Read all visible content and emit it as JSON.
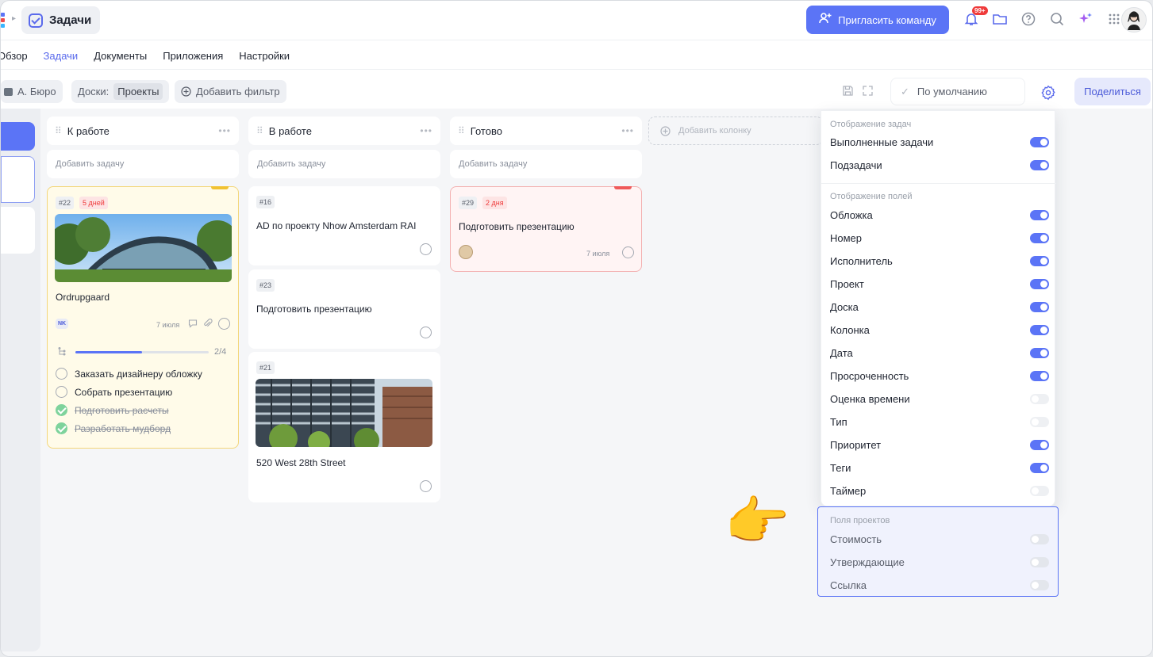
{
  "app": {
    "title": "Задачи",
    "invite_label": "Пригласить команду",
    "notifications_badge": "99+"
  },
  "nav": {
    "tabs": [
      {
        "label": "Обзор",
        "active": false
      },
      {
        "label": "Задачи",
        "active": true
      },
      {
        "label": "Документы",
        "active": false
      },
      {
        "label": "Приложения",
        "active": false
      },
      {
        "label": "Настройки",
        "active": false
      }
    ]
  },
  "filters": {
    "workspace": "А. Бюро",
    "boards_label": "Доски:",
    "boards_value": "Проекты",
    "add_filter": "Добавить фильтр",
    "view": "По умолчанию",
    "share": "Поделиться"
  },
  "board": {
    "add_task_label": "Добавить задачу",
    "add_column_label": "Добавить колонку",
    "columns": [
      {
        "name": "К работе",
        "cards": [
          {
            "number": "#22",
            "overdue": "5 дней",
            "title": "Ordrupgaard",
            "assignee": "NK",
            "date": "7 июля",
            "progress": "2/4",
            "progress_fraction": 0.5,
            "subtasks": [
              {
                "label": "Заказать дизайнеру обложку",
                "done": false
              },
              {
                "label": "Собрать презентацию",
                "done": false
              },
              {
                "label": "Подготовить расчеты",
                "done": true
              },
              {
                "label": "Разработать мудборд",
                "done": true
              }
            ]
          }
        ]
      },
      {
        "name": "В работе",
        "cards": [
          {
            "number": "#16",
            "title": "AD по проекту Nhow Amsterdam RAI"
          },
          {
            "number": "#23",
            "title": "Подготовить презентацию"
          },
          {
            "number": "#21",
            "title": "520 West 28th Street"
          }
        ]
      },
      {
        "name": "Готово",
        "cards": [
          {
            "number": "#29",
            "overdue": "2 дня",
            "title": "Подготовить презентацию",
            "date": "7 июля"
          }
        ]
      }
    ]
  },
  "settings": {
    "task_display": {
      "title": "Отображение задач",
      "items": [
        {
          "label": "Выполненные задачи",
          "on": true
        },
        {
          "label": "Подзадачи",
          "on": true
        }
      ]
    },
    "field_display": {
      "title": "Отображение полей",
      "items": [
        {
          "label": "Обложка",
          "on": true
        },
        {
          "label": "Номер",
          "on": true
        },
        {
          "label": "Исполнитель",
          "on": true
        },
        {
          "label": "Проект",
          "on": true
        },
        {
          "label": "Доска",
          "on": true
        },
        {
          "label": "Колонка",
          "on": true
        },
        {
          "label": "Дата",
          "on": true
        },
        {
          "label": "Просроченность",
          "on": true
        },
        {
          "label": "Оценка времени",
          "on": false
        },
        {
          "label": "Тип",
          "on": false
        },
        {
          "label": "Приоритет",
          "on": true
        },
        {
          "label": "Теги",
          "on": true
        },
        {
          "label": "Таймер",
          "on": false
        }
      ]
    },
    "project_fields": {
      "title": "Поля проектов",
      "items": [
        {
          "label": "Стоимость",
          "on": false
        },
        {
          "label": "Утверждающие",
          "on": false
        },
        {
          "label": "Ссылка",
          "on": false
        }
      ]
    }
  },
  "colors": {
    "accent": "#5b74f6",
    "overdue": "#ef3b3b",
    "done": "#7ed39c"
  }
}
